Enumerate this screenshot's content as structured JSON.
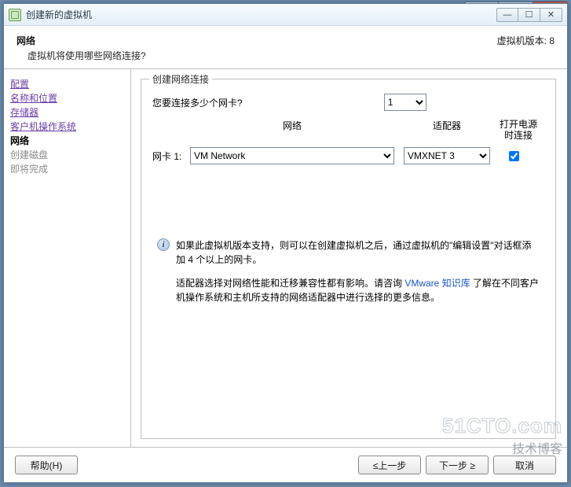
{
  "dialog": {
    "title": "创建新的虚拟机",
    "version_label": "虚拟机版本: 8"
  },
  "header": {
    "title": "网络",
    "subtitle": "虚拟机将使用哪些网络连接?"
  },
  "steps": {
    "config": "配置",
    "name_loc": "名称和位置",
    "storage": "存储器",
    "guest_os": "客户机操作系统",
    "network": "网络",
    "create_disk": "创建磁盘",
    "ready": "即将完成"
  },
  "group": {
    "legend": "创建网络连接",
    "question": "您要连接多少个网卡?",
    "count_value": "1",
    "col_network": "网络",
    "col_adapter": "适配器",
    "col_power_l1": "打开电源",
    "col_power_l2": "时连接",
    "nic1_label": "网卡 1:",
    "nic1_network": "VM Network",
    "nic1_adapter": "VMXNET 3"
  },
  "info": {
    "note1": "如果此虚拟机版本支持，则可以在创建虚拟机之后，通过虚拟机的\"编辑设置\"对话框添加 4 个以上的网卡。",
    "note2_pre": "适配器选择对网络性能和迁移兼容性都有影响。请咨询 ",
    "note2_link": "VMware 知识库",
    "note2_post": " 了解在不同客户机操作系统和主机所支持的网络适配器中进行选择的更多信息。"
  },
  "buttons": {
    "help": "帮助(H)",
    "back": "≤上一步",
    "next": "下一步 ≥",
    "cancel": "取消"
  },
  "watermark": {
    "l1": "51CTO.com",
    "l2": "技术博客"
  }
}
